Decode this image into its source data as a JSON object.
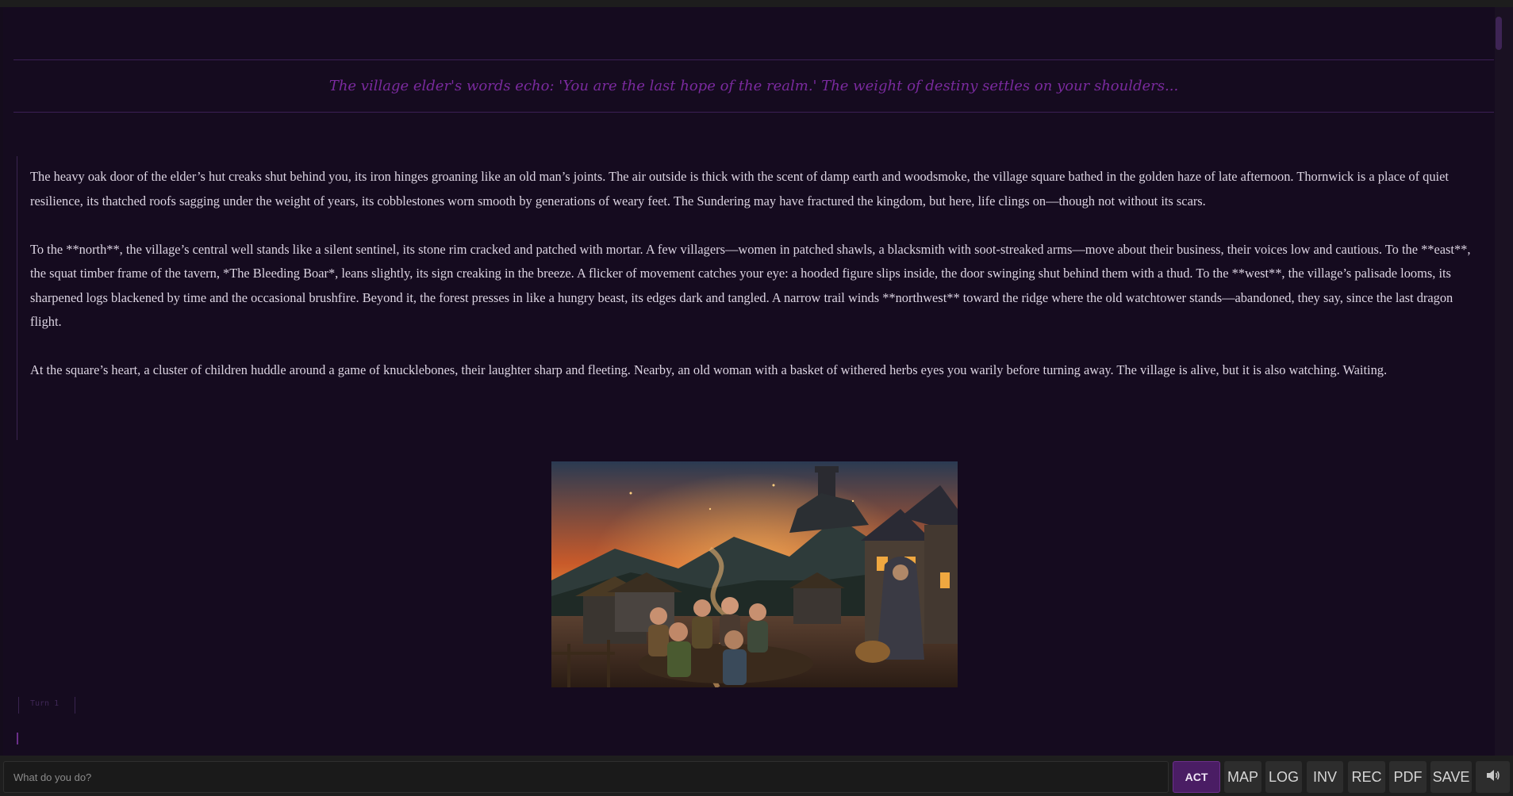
{
  "banner": {
    "text": "The village elder's words echo: 'You are the last hope of the realm.' The weight of destiny settles on your shoulders..."
  },
  "narrative": {
    "paragraphs": [
      "The heavy oak door of the elder’s hut creaks shut behind you, its iron hinges groaning like an old man’s joints. The air outside is thick with the scent of damp earth and woodsmoke, the village square bathed in the golden haze of late afternoon. Thornwick is a place of quiet resilience, its thatched roofs sagging under the weight of years, its cobblestones worn smooth by generations of weary feet. The Sundering may have fractured the kingdom, but here, life clings on—though not without its scars.",
      "To the **north**, the village’s central well stands like a silent sentinel, its stone rim cracked and patched with mortar. A few villagers—women in patched shawls, a blacksmith with soot-streaked arms—move about their business, their voices low and cautious. To the **east**, the squat timber frame of the tavern, *The Bleeding Boar*, leans slightly, its sign creaking in the breeze. A flicker of movement catches your eye: a hooded figure slips inside, the door swinging shut behind them with a thud. To the **west**, the village’s palisade looms, its sharpened logs blackened by time and the occasional brushfire. Beyond it, the forest presses in like a hungry beast, its edges dark and tangled. A narrow trail winds **northwest** toward the ridge where the old watchtower stands—abandoned, they say, since the last dragon flight.",
      "At the square’s heart, a cluster of children huddle around a game of knucklebones, their laughter sharp and fleeting. Nearby, an old woman with a basket of withered herbs eyes you warily before turning away. The village is alive, but it is also watching. Waiting."
    ]
  },
  "turn": {
    "label": "Turn 1"
  },
  "input": {
    "placeholder": "What do you do?",
    "value": ""
  },
  "buttons": {
    "act": "ACT",
    "map": "MAP",
    "log": "LOG",
    "inv": "INV",
    "rec": "REC",
    "pdf": "PDF",
    "save": "SAVE",
    "sound_icon": "speaker-icon"
  },
  "colors": {
    "background": "#150b1f",
    "accent": "#7a2a9e",
    "act_button": "#4a1d64",
    "text": "#dcd4e2"
  }
}
